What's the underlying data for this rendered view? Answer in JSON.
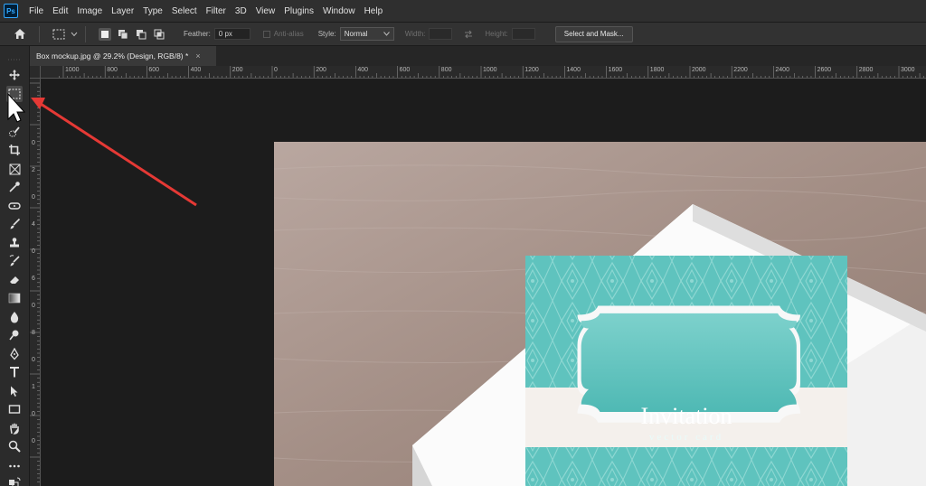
{
  "app": {
    "logo": "Ps"
  },
  "menu": [
    "File",
    "Edit",
    "Image",
    "Layer",
    "Type",
    "Select",
    "Filter",
    "3D",
    "View",
    "Plugins",
    "Window",
    "Help"
  ],
  "options": {
    "feather_label": "Feather:",
    "feather_value": "0 px",
    "antialias_label": "Anti-alias",
    "style_label": "Style:",
    "style_value": "Normal",
    "width_label": "Width:",
    "height_label": "Height:",
    "select_mask_button": "Select and Mask..."
  },
  "document": {
    "tab_title": "Box mockup.jpg @ 29.2% (Design, RGB/8) *",
    "close": "×"
  },
  "ruler": {
    "top_labels": [
      "1000",
      "800",
      "600",
      "400",
      "200",
      "0",
      "200",
      "400",
      "600",
      "800",
      "1000",
      "1200",
      "1400",
      "1600",
      "1800",
      "2000",
      "2200",
      "2400",
      "2600",
      "2800",
      "3000"
    ],
    "left_labels": [
      "0",
      "2",
      "0",
      "4",
      "0",
      "6",
      "0",
      "8",
      "0",
      "1",
      "0",
      "0"
    ]
  },
  "tools": [
    "move-tool",
    "rectangular-marquee-tool",
    "quick-selection-tool",
    "crop-tool",
    "frame-tool",
    "eyedropper-tool",
    "spot-healing-tool",
    "brush-tool",
    "clone-stamp-tool",
    "history-brush-tool",
    "eraser-tool",
    "gradient-tool",
    "blur-tool",
    "dodge-tool",
    "pen-tool",
    "type-tool",
    "path-selection-tool",
    "rectangle-tool",
    "hand-tool",
    "zoom-tool",
    "edit-toolbar",
    "swap-colors"
  ],
  "artwork": {
    "title": "Invitation",
    "subtitle": "vector card"
  },
  "colors": {
    "teal": "#5bc0bc",
    "annotation_arrow": "#e53935",
    "wood": "#a48f85"
  }
}
